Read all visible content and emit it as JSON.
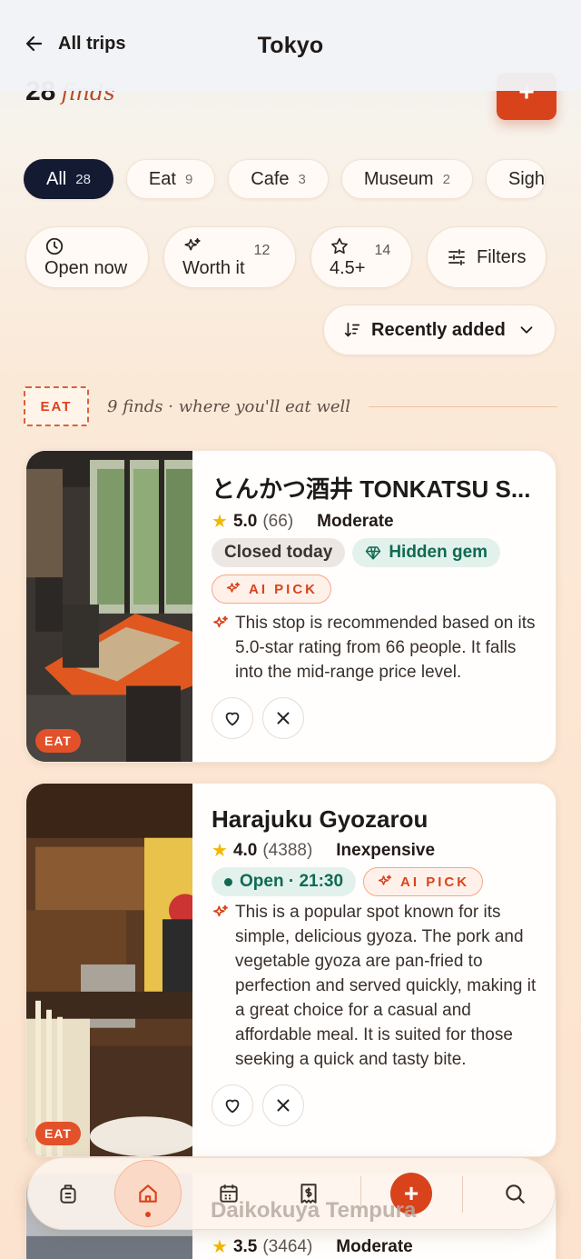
{
  "header": {
    "back_label": "All trips",
    "title": "Tokyo"
  },
  "summary": {
    "count": "28",
    "label": "finds",
    "add_label": "+"
  },
  "categories": [
    {
      "label": "All",
      "count": "28"
    },
    {
      "label": "Eat",
      "count": "9"
    },
    {
      "label": "Cafe",
      "count": "3"
    },
    {
      "label": "Museum",
      "count": "2"
    },
    {
      "label": "Sigh",
      "count": ""
    }
  ],
  "filters": {
    "open_now": "Open now",
    "worth_it": "Worth it",
    "worth_it_count": "12",
    "rating": "4.5+",
    "rating_count": "14",
    "filters": "Filters"
  },
  "sort": {
    "label": "Recently added"
  },
  "section": {
    "stamp": "EAT",
    "text": "9 finds · where you'll eat well"
  },
  "cards": [
    {
      "name": "とんかつ酒井 TONKATSU S...",
      "rating": "5.0",
      "reviews": "(66)",
      "price": "Moderate",
      "status": "Closed today",
      "gem": "Hidden gem",
      "ai": "AI PICK",
      "description": "This stop is recommended based on its 5.0-star rating from 66 people. It falls into the mid-range price level.",
      "tag": "EAT"
    },
    {
      "name": "Harajuku Gyozarou",
      "rating": "4.0",
      "reviews": "(4388)",
      "price": "Inexpensive",
      "status": "Open · 21:30",
      "ai": "AI PICK",
      "description": "This is a popular spot known for its simple, delicious gyoza. The pork and vegetable gyoza are pan-fried to perfection and served quickly, making it a great choice for a casual and affordable meal. It is suited for those seeking a quick and tasty bite.",
      "tag": "EAT"
    },
    {
      "name": "Daikokuya Tempura",
      "rating": "3.5",
      "reviews": "(3464)",
      "price": "Moderate"
    }
  ],
  "nav": {
    "plus": "+"
  },
  "colors": {
    "accent": "#d9431b",
    "navy": "#151a33",
    "green": "#0f6a52",
    "star": "#f2b705"
  }
}
